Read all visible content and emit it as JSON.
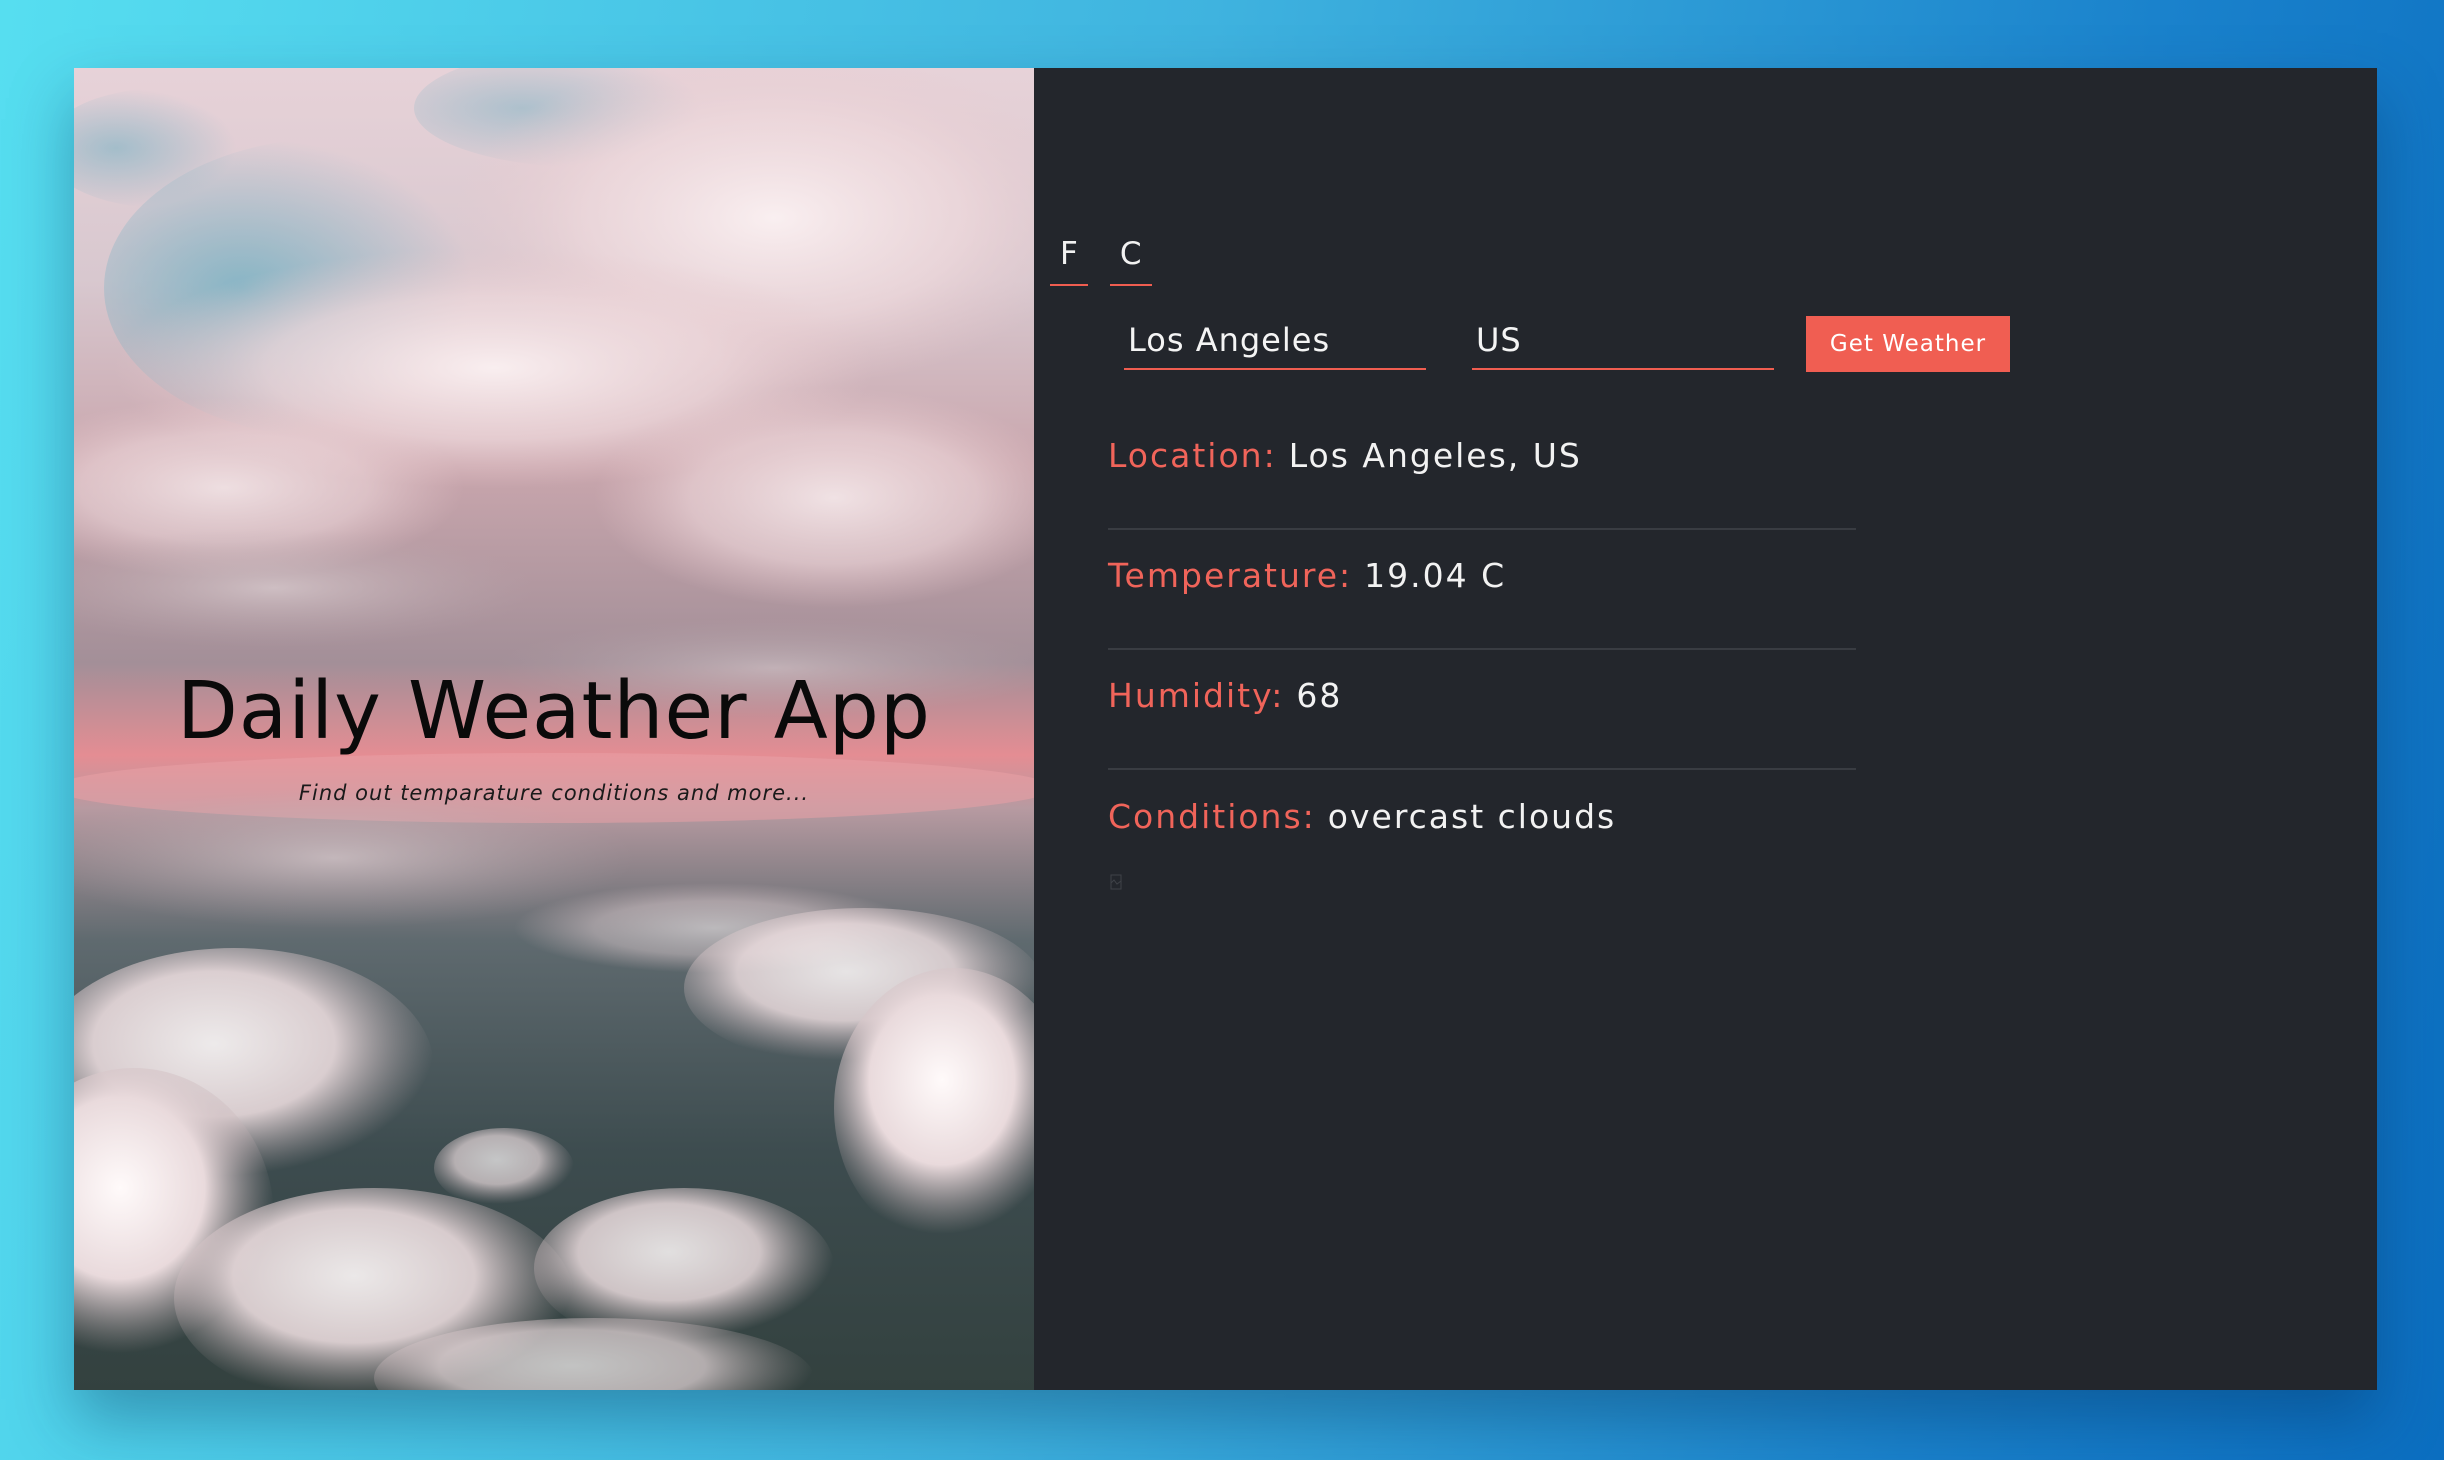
{
  "hero": {
    "title": "Daily Weather App",
    "subtitle": "Find out temparature conditions and more..."
  },
  "units": {
    "fahrenheit_label": "F",
    "celsius_label": "C"
  },
  "form": {
    "city_value": "Los Angeles",
    "country_value": "US",
    "submit_label": "Get Weather"
  },
  "results": {
    "location_label": "Location:",
    "location_value": "Los Angeles, US",
    "temperature_label": "Temperature:",
    "temperature_value": "19.04 C",
    "humidity_label": "Humidity:",
    "humidity_value": "68",
    "conditions_label": "Conditions:",
    "conditions_value": "overcast clouds"
  },
  "colors": {
    "accent": "#f05e52",
    "panel_bg": "#23262c",
    "page_gradient_start": "#56def0",
    "page_gradient_end": "#0b6ec0"
  },
  "icons": {
    "weather_icon": "broken-image-icon"
  }
}
